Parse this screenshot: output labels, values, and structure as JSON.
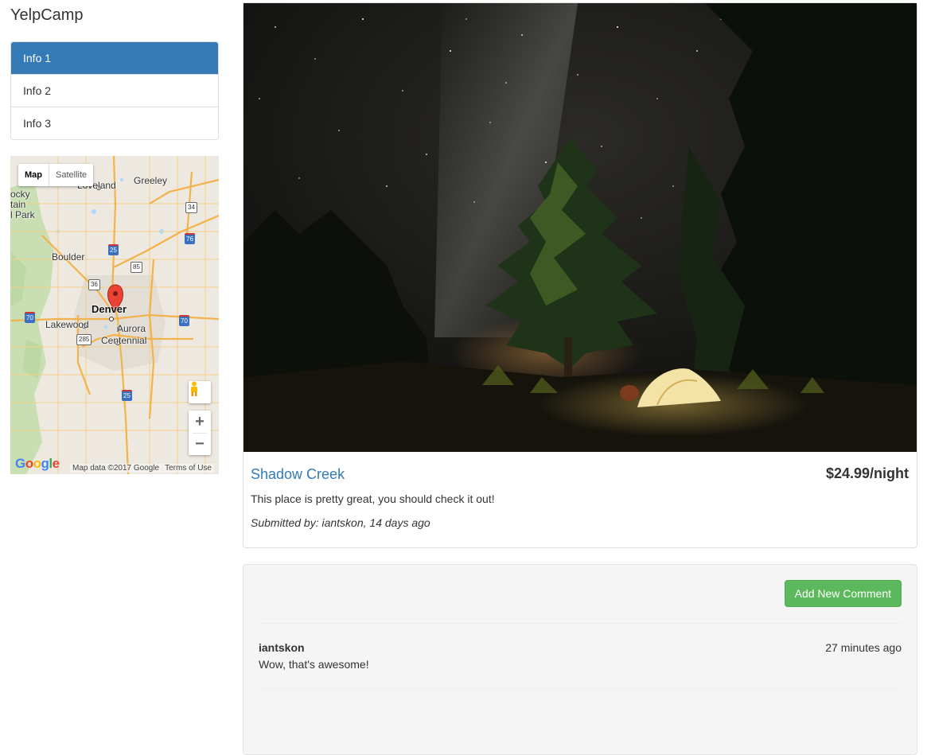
{
  "brand": "YelpCamp",
  "sidebar": {
    "items": [
      {
        "label": "Info 1",
        "active": true
      },
      {
        "label": "Info 2",
        "active": false
      },
      {
        "label": "Info 3",
        "active": false
      }
    ]
  },
  "map": {
    "type_buttons": {
      "map": "Map",
      "satellite": "Satellite"
    },
    "cities": {
      "greeley": "Greeley",
      "loveland": "Loveland",
      "boulder": "Boulder",
      "denver": "Denver",
      "lakewood": "Lakewood",
      "aurora": "Aurora",
      "centennial": "Centennial",
      "park_partial": "ocky\ntain\nl Park"
    },
    "shields": {
      "i25_north": "25",
      "i25_south": "25",
      "i76": "76",
      "i70_west": "70",
      "i70_east": "70",
      "us34": "34",
      "us36": "36",
      "us85": "85",
      "us285": "285"
    },
    "logo": "Google",
    "attribution": "Map data ©2017 Google",
    "terms": "Terms of Use",
    "zoom_in": "+",
    "zoom_out": "−"
  },
  "campground": {
    "name": "Shadow Creek",
    "price": "$24.99/night",
    "description": "This place is pretty great, you should check it out!",
    "submitted": "Submitted by: iantskon, 14 days ago"
  },
  "comments": {
    "add_button": "Add New Comment",
    "items": [
      {
        "author": "iantskon",
        "time": "27 minutes ago",
        "text": "Wow, that's awesome!"
      }
    ]
  },
  "colors": {
    "primary": "#337ab7",
    "success": "#5cb85c"
  }
}
